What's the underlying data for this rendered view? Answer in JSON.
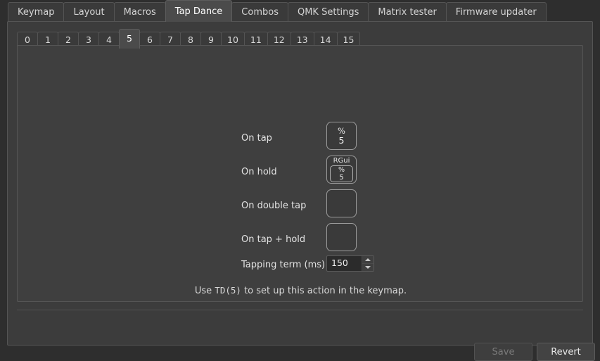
{
  "app_tabs": [
    {
      "label": "Keymap",
      "selected": false
    },
    {
      "label": "Layout",
      "selected": false
    },
    {
      "label": "Macros",
      "selected": false
    },
    {
      "label": "Tap Dance",
      "selected": true
    },
    {
      "label": "Combos",
      "selected": false
    },
    {
      "label": "QMK Settings",
      "selected": false
    },
    {
      "label": "Matrix tester",
      "selected": false
    },
    {
      "label": "Firmware updater",
      "selected": false
    }
  ],
  "index_tabs": [
    {
      "label": "0",
      "selected": false
    },
    {
      "label": "1",
      "selected": false
    },
    {
      "label": "2",
      "selected": false
    },
    {
      "label": "3",
      "selected": false
    },
    {
      "label": "4",
      "selected": false
    },
    {
      "label": "5",
      "selected": true
    },
    {
      "label": "6",
      "selected": false
    },
    {
      "label": "7",
      "selected": false
    },
    {
      "label": "8",
      "selected": false
    },
    {
      "label": "9",
      "selected": false
    },
    {
      "label": "10",
      "selected": false
    },
    {
      "label": "11",
      "selected": false
    },
    {
      "label": "12",
      "selected": false
    },
    {
      "label": "13",
      "selected": false
    },
    {
      "label": "14",
      "selected": false
    },
    {
      "label": "15",
      "selected": false
    }
  ],
  "form": {
    "on_tap": {
      "label": "On tap",
      "key_top": "%",
      "key_bottom": "5",
      "modifier": ""
    },
    "on_hold": {
      "label": "On hold",
      "key_top": "%",
      "key_bottom": "5",
      "modifier": "RGui"
    },
    "on_double_tap": {
      "label": "On double tap",
      "key_top": "",
      "key_bottom": "",
      "modifier": ""
    },
    "on_tap_hold": {
      "label": "On tap + hold",
      "key_top": "",
      "key_bottom": "",
      "modifier": ""
    },
    "tapping_term": {
      "label": "Tapping term (ms)",
      "value": "150"
    }
  },
  "hint": {
    "prefix": "Use ",
    "code": "TD(5)",
    "suffix": " to set up this action in the keymap."
  },
  "footer": {
    "save_label": "Save",
    "revert_label": "Revert"
  },
  "colors": {
    "window_bg": "#2e2e2e",
    "panel_bg": "#3c3c3c",
    "content_bg": "#3f3f3f",
    "tab_bg": "#3a3a3a",
    "tab_selected_bg": "#4b4b4b",
    "border": "#555555",
    "key_border": "#9b9b9b",
    "text": "#e6e6e6",
    "text_disabled": "#7a7a7a",
    "input_bg": "#2b2b2b"
  }
}
